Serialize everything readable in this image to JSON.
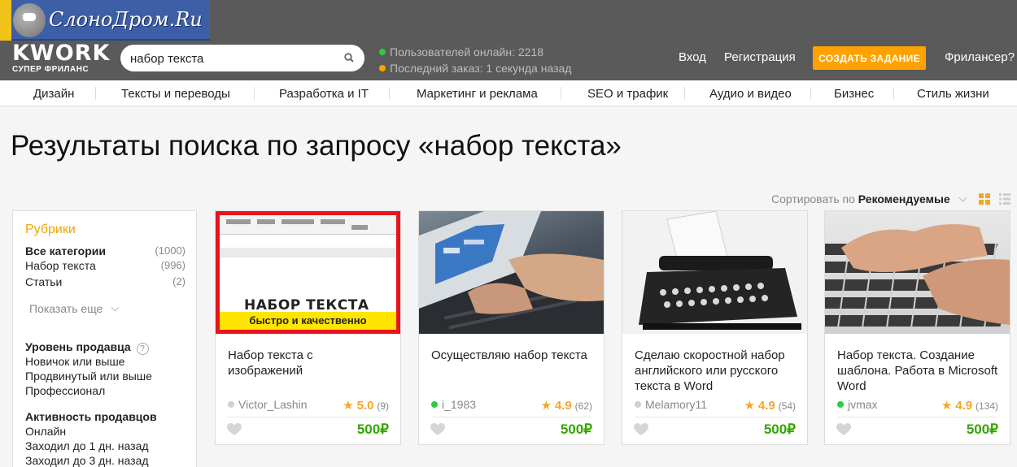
{
  "watermark": {
    "text": "СлоноДром.Ru"
  },
  "logo": {
    "name": "KWORK",
    "tagline": "СУПЕР ФРИЛАНС"
  },
  "search": {
    "value": "набор текста"
  },
  "stats": {
    "online": "Пользователей онлайн: 2218",
    "last_order": "Последний заказ: 1 секунда назад",
    "online_color": "#2ecc40",
    "order_color": "#ffa200"
  },
  "header": {
    "login": "Вход",
    "register": "Регистрация",
    "create": "СОЗДАТЬ ЗАДАНИЕ",
    "freelancer": "Фрилансер?"
  },
  "categories": [
    "Дизайн",
    "Тексты и переводы",
    "Разработка и IT",
    "Маркетинг и реклама",
    "SEO и трафик",
    "Аудио и видео",
    "Бизнес",
    "Стиль жизни"
  ],
  "page_title": "Результаты поиска по запросу «набор текста»",
  "sort": {
    "label": "Сортировать по",
    "value": "Рекомендуемые"
  },
  "sidebar": {
    "title": "Рубрики",
    "rubrics": [
      {
        "label": "Все категории",
        "count": "(1000)"
      },
      {
        "label": "Набор текста",
        "count": "(996)"
      },
      {
        "label": "Статьи",
        "count": "(2)"
      }
    ],
    "show_more": "Показать еще",
    "seller_level": {
      "title": "Уровень продавца",
      "help": "?",
      "items": [
        "Новичок или выше",
        "Продвинутый или выше",
        "Профессионал"
      ]
    },
    "seller_activity": {
      "title": "Активность продавцов",
      "items": [
        "Онлайн",
        "Заходил до 1 дн. назад",
        "Заходил до 3 дн. назад"
      ]
    }
  },
  "cards": [
    {
      "title": "Набор текста с изображений",
      "seller": "Victor_Lashin",
      "online": false,
      "rating": "5.0",
      "reviews": "(9)",
      "price": "500₽",
      "thumb_main": "НАБОР ТЕКСТА",
      "thumb_sub": "быстро и качественно"
    },
    {
      "title": "Осуществляю набор текста",
      "seller": "i_1983",
      "online": true,
      "rating": "4.9",
      "reviews": "(62)",
      "price": "500₽"
    },
    {
      "title": "Сделаю скоростной набор английского или русского текста в Word",
      "seller": "Melamory11",
      "online": false,
      "rating": "4.9",
      "reviews": "(54)",
      "price": "500₽"
    },
    {
      "title": "Набор текста. Создание шаблона. Работа в Microsoft Word",
      "seller": "jvmax",
      "online": true,
      "rating": "4.9",
      "reviews": "(134)",
      "price": "500₽"
    }
  ],
  "colors": {
    "accent": "#ffa200",
    "price": "#34a500",
    "online": "#2ecc40",
    "offline": "#d0d0d0",
    "star": "#f5a623"
  }
}
